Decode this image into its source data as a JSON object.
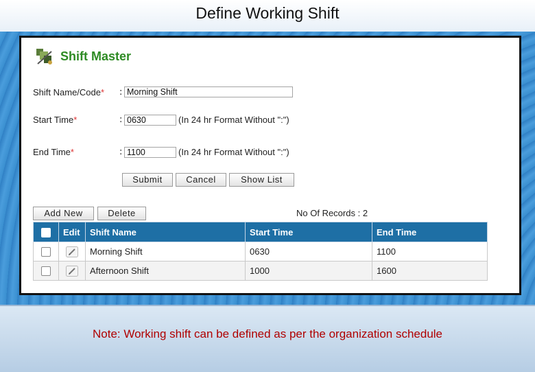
{
  "slide": {
    "title": "Define Working Shift",
    "note": "Note: Working shift can be defined as per the organization schedule"
  },
  "panel": {
    "title": "Shift Master",
    "logo_icon": "shift-master-icon"
  },
  "form": {
    "shift_name": {
      "label": "Shift Name/Code",
      "required": "*",
      "colon": ":",
      "value": "Morning Shift"
    },
    "start_time": {
      "label": "Start Time",
      "required": "*",
      "colon": ":",
      "value": "0630",
      "hint": "(In 24 hr Format Without \":\")"
    },
    "end_time": {
      "label": "End Time",
      "required": "*",
      "colon": ":",
      "value": "1100",
      "hint": "(In 24 hr Format Without \":\")"
    },
    "buttons": {
      "submit": "Submit",
      "cancel": "Cancel",
      "show_list": "Show List"
    }
  },
  "toolbar": {
    "add_new": "Add New",
    "delete": "Delete",
    "records_label": "No Of Records :",
    "records_count": "2"
  },
  "table": {
    "headers": {
      "edit": "Edit",
      "shift_name": "Shift Name",
      "start_time": "Start Time",
      "end_time": "End Time"
    },
    "rows": [
      {
        "shift_name": "Morning Shift",
        "start_time": "0630",
        "end_time": "1100"
      },
      {
        "shift_name": "Afternoon Shift",
        "start_time": "1000",
        "end_time": "1600"
      }
    ]
  },
  "colors": {
    "header_blue": "#1e6fa5",
    "title_green": "#2e8b24",
    "note_red": "#b00000",
    "required_red": "#d33333"
  }
}
